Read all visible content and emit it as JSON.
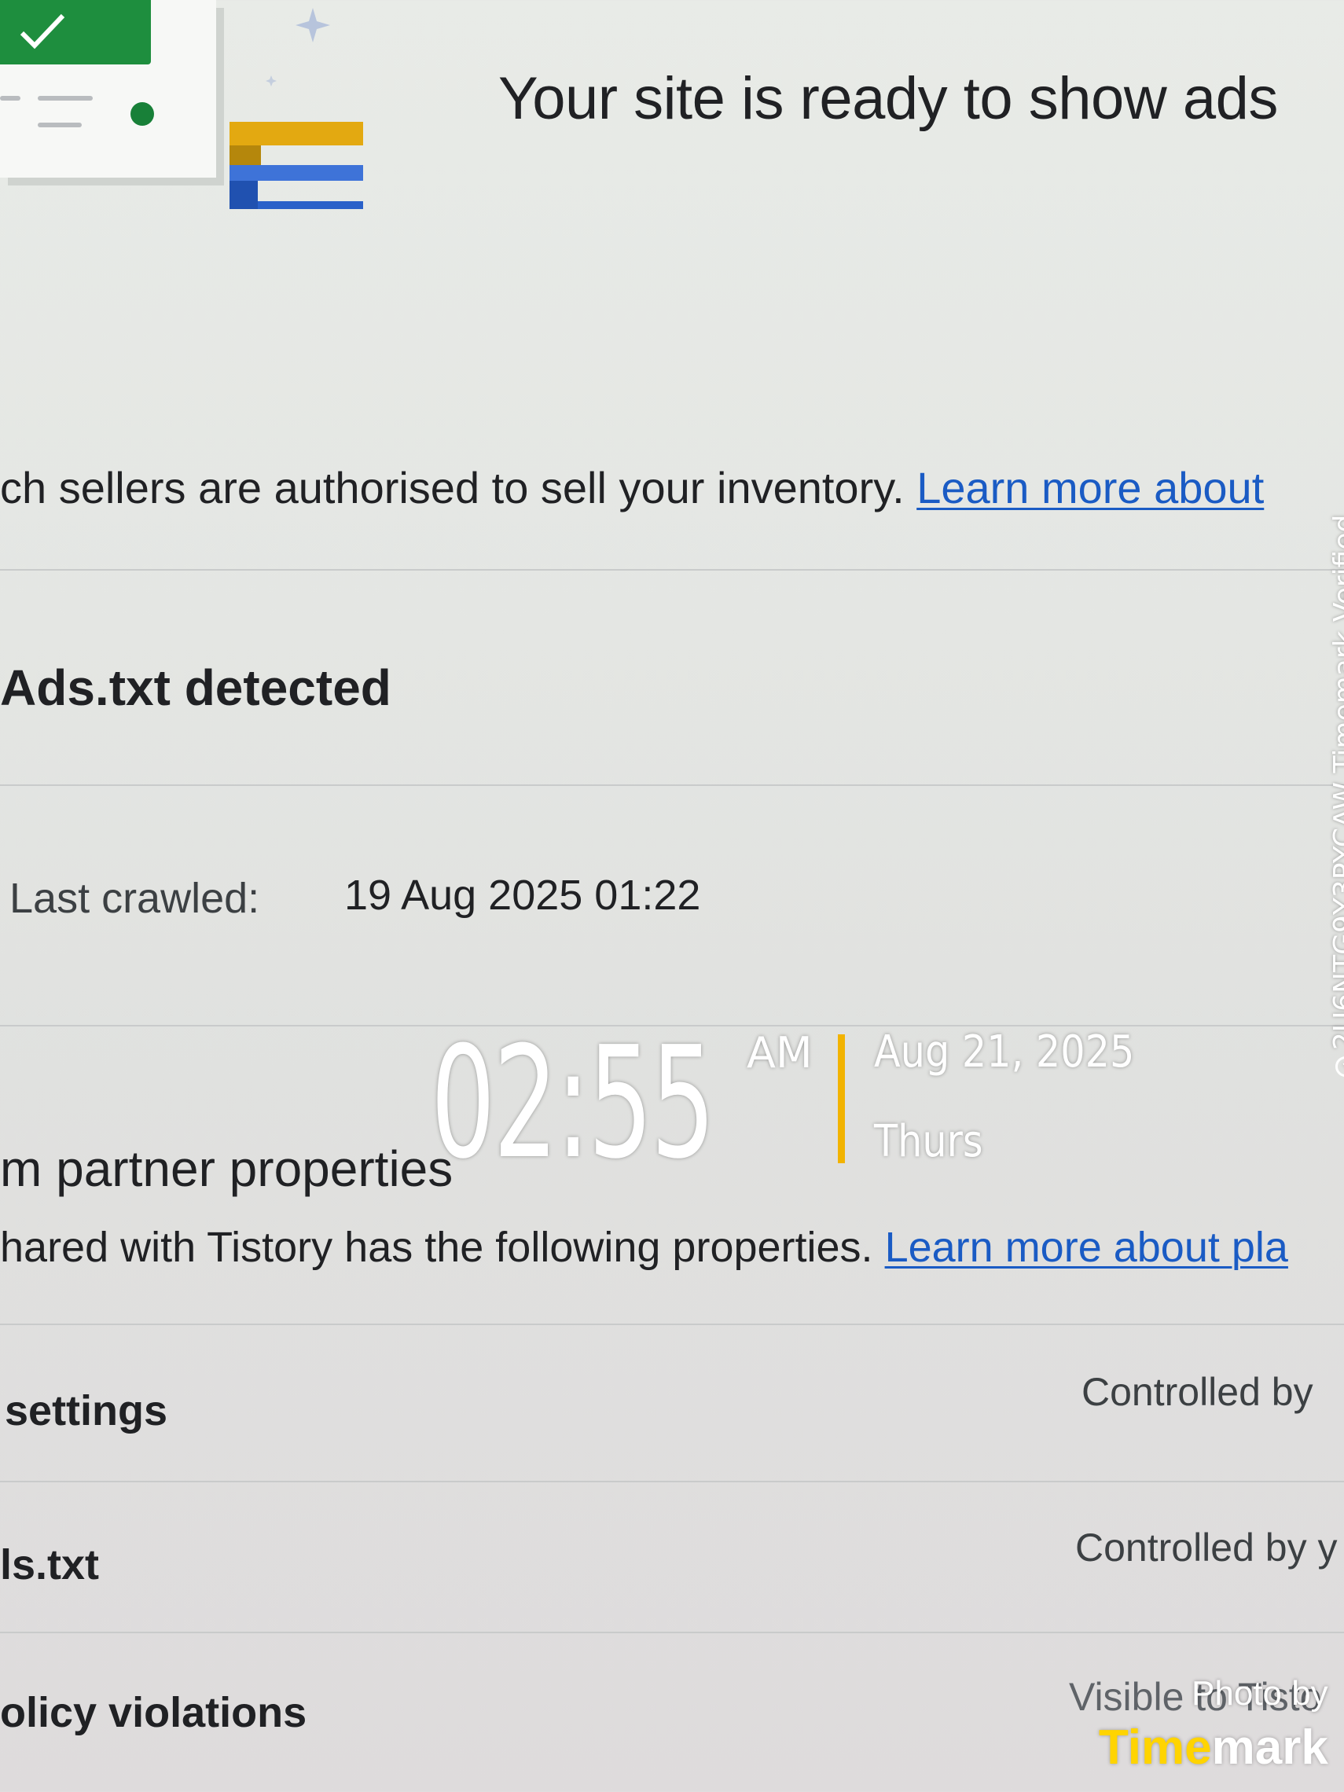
{
  "header": {
    "title": "Your site is ready to show ads"
  },
  "ads_txt": {
    "description": "ch sellers are authorised to sell your inventory.",
    "learn_more": "Learn more about",
    "status": "Ads.txt detected",
    "last_crawled_label": "Last crawled:",
    "last_crawled_value": "19 Aug 2025 01:22"
  },
  "partner": {
    "title": "m partner properties",
    "description": "hared with Tistory has the following properties.",
    "learn_more": "Learn more about pla"
  },
  "settings_rows": [
    {
      "label": "settings",
      "control": "Controlled by"
    },
    {
      "label": "ls.txt",
      "control": "Controlled by y"
    },
    {
      "label": "olicy violations",
      "control": "Visible to Tisto"
    }
  ],
  "overlay": {
    "time": "02:55",
    "ampm": "AM",
    "date": "Aug 21, 2025",
    "day": "Thurs",
    "verification": "2U6NTG9Y3PYCAW  Timemark Verified",
    "photo_by": "Photo by",
    "brand_a": "Time",
    "brand_b": "mark"
  },
  "colors": {
    "accent_green": "#1e8e3e",
    "link_blue": "#1a5bc4",
    "timemark_yellow": "#ffd400",
    "separator_yellow": "#f2b300"
  }
}
